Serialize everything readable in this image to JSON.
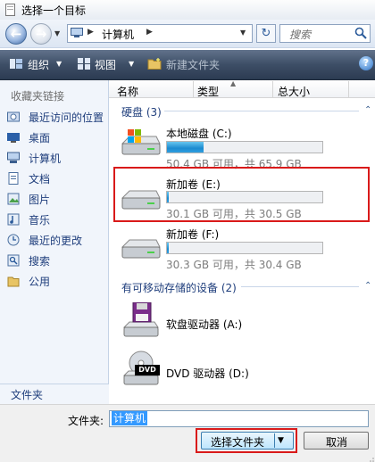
{
  "window": {
    "title": "选择一个目标"
  },
  "nav": {
    "address_root": "计算机",
    "search_placeholder": "搜索"
  },
  "toolbar": {
    "organize_label": "组织",
    "view_label": "视图",
    "new_folder_label": "新建文件夹"
  },
  "sidebar": {
    "favorites_title": "收藏夹链接",
    "items": [
      {
        "label": "最近访问的位置",
        "icon": "recent-places-icon"
      },
      {
        "label": "桌面",
        "icon": "desktop-icon"
      },
      {
        "label": "计算机",
        "icon": "computer-icon"
      },
      {
        "label": "文档",
        "icon": "documents-icon"
      },
      {
        "label": "图片",
        "icon": "pictures-icon"
      },
      {
        "label": "音乐",
        "icon": "music-icon"
      },
      {
        "label": "最近的更改",
        "icon": "recent-changes-icon"
      },
      {
        "label": "搜索",
        "icon": "search-icon"
      },
      {
        "label": "公用",
        "icon": "public-folder-icon"
      }
    ],
    "folders_label": "文件夹"
  },
  "columns": [
    "名称",
    "类型",
    "总大小"
  ],
  "groups": {
    "hard_disks": "硬盘 (3)",
    "removable": "有可移动存储的设备 (2)"
  },
  "drives": [
    {
      "name": "本地磁盘 (C:)",
      "info": "50.4 GB 可用，共 65.9 GB",
      "used_fraction": 0.235
    },
    {
      "name": "新加卷 (E:)",
      "info": "30.1 GB 可用，共 30.5 GB",
      "used_fraction": 0.013
    },
    {
      "name": "新加卷 (F:)",
      "info": "30.3 GB 可用，共 30.4 GB",
      "used_fraction": 0.003
    }
  ],
  "removable_devices": [
    {
      "name": "软盘驱动器 (A:)",
      "icon": "floppy-drive-icon"
    },
    {
      "name": "DVD 驱动器 (D:)",
      "icon": "dvd-drive-icon",
      "badge": "DVD"
    }
  ],
  "bottom": {
    "folder_label": "文件夹:",
    "folder_value": "计算机",
    "select_button": "选择文件夹",
    "cancel_button": "取消"
  },
  "colors": {
    "highlight_border": "#d91a1a",
    "link_text": "#1f3e7c",
    "drive_bar_fill": "#1c8bd0"
  }
}
